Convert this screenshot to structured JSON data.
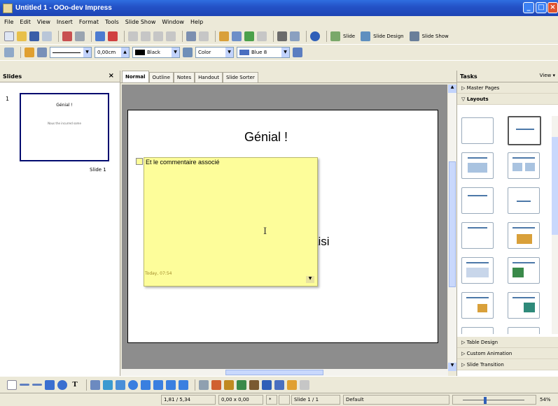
{
  "window": {
    "title": "Untitled 1 - OOo-dev Impress",
    "minimize": "_",
    "maximize": "□",
    "close": "×"
  },
  "menu": [
    "File",
    "Edit",
    "View",
    "Insert",
    "Format",
    "Tools",
    "Slide Show",
    "Window",
    "Help"
  ],
  "toolbar1": {
    "slide_label": "Slide",
    "slide_design_label": "Slide Design",
    "slide_show_label": "Slide Show"
  },
  "toolbar2": {
    "line_width": "0,00cm",
    "line_color": "Black",
    "area_style": "Color",
    "area_color": "Blue 8"
  },
  "slides_panel": {
    "title": "Slides",
    "close": "×",
    "thumb_title": "Génial !",
    "thumb_text": "Nous the incurred some",
    "slide_label": "Slide 1"
  },
  "tabs": [
    "Normal",
    "Outline",
    "Notes",
    "Handout",
    "Slide Sorter"
  ],
  "slide": {
    "title": "Génial !",
    "body_fragment": "aisi"
  },
  "comment": {
    "text": "Et le commentaire associé",
    "timestamp": "Today, 07:54",
    "cursor": "I"
  },
  "tasks_panel": {
    "title": "Tasks",
    "view": "View ▾",
    "sections_top": [
      "▷ Master Pages",
      "▽ Layouts"
    ],
    "sections_bottom": [
      "▷ Table Design",
      "▷ Custom Animation",
      "▷ Slide Transition"
    ]
  },
  "status": {
    "position": "1,81 / 5,34",
    "size": "0,00 x 0,00",
    "slide": "Slide 1 / 1",
    "layout": "Default",
    "zoom": "54%"
  },
  "colors": {
    "title_bar": "#2453c8",
    "sticky_note": "#fdfd9a",
    "canvas": "#8d8d8d",
    "chrome": "#ece9d8"
  }
}
